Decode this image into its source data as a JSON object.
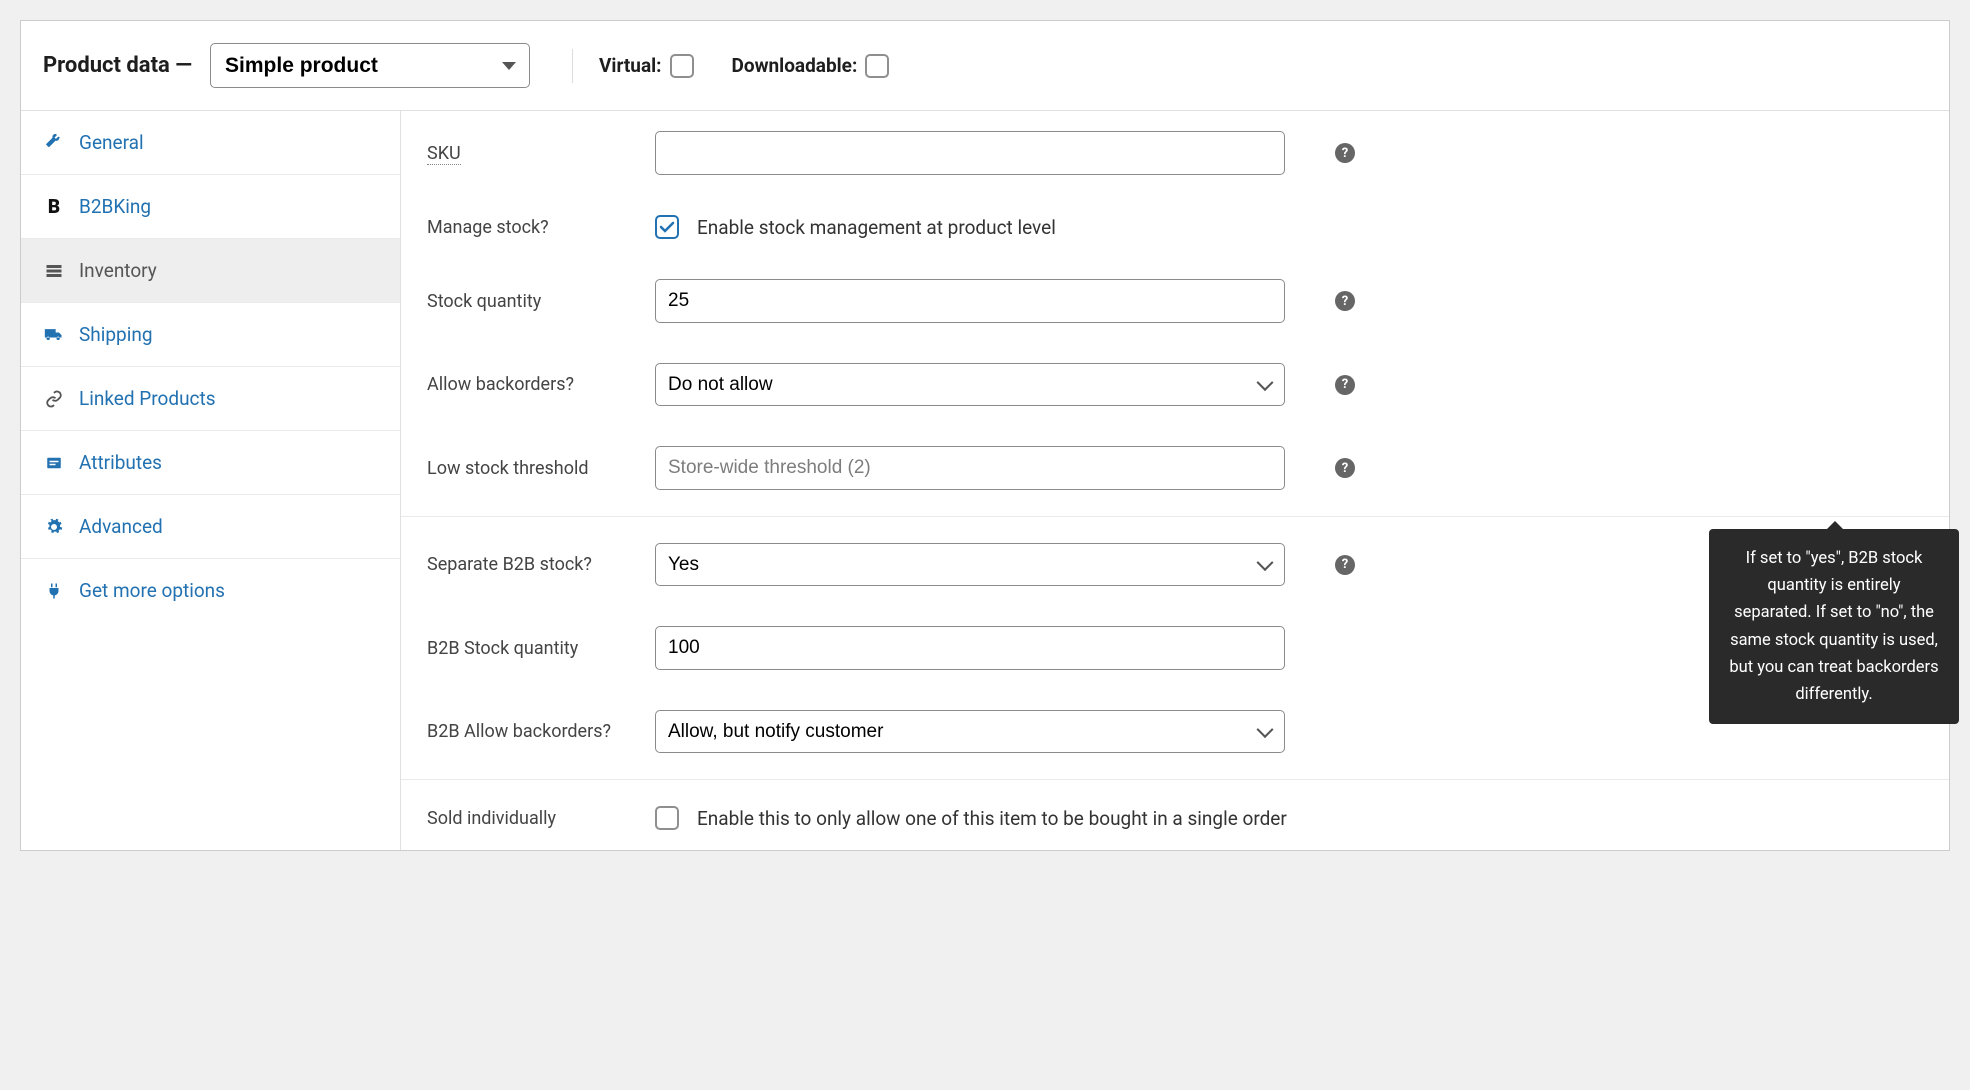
{
  "header": {
    "title": "Product data —",
    "product_type": "Simple product",
    "virtual_label": "Virtual:",
    "downloadable_label": "Downloadable:",
    "virtual_checked": false,
    "downloadable_checked": false
  },
  "tabs": [
    {
      "id": "general",
      "label": "General",
      "icon": "wrench"
    },
    {
      "id": "b2bking",
      "label": "B2BKing",
      "icon": "b2b"
    },
    {
      "id": "inventory",
      "label": "Inventory",
      "icon": "list",
      "active": true
    },
    {
      "id": "shipping",
      "label": "Shipping",
      "icon": "truck"
    },
    {
      "id": "linked",
      "label": "Linked Products",
      "icon": "link"
    },
    {
      "id": "attributes",
      "label": "Attributes",
      "icon": "note"
    },
    {
      "id": "advanced",
      "label": "Advanced",
      "icon": "gear"
    },
    {
      "id": "more",
      "label": "Get more options",
      "icon": "plug"
    }
  ],
  "form": {
    "sku_label": "SKU",
    "sku_value": "",
    "manage_stock_label": "Manage stock?",
    "manage_stock_desc": "Enable stock management at product level",
    "manage_stock_checked": true,
    "stock_qty_label": "Stock quantity",
    "stock_qty_value": "25",
    "allow_backorders_label": "Allow backorders?",
    "allow_backorders_value": "Do not allow",
    "low_stock_label": "Low stock threshold",
    "low_stock_placeholder": "Store-wide threshold (2)",
    "low_stock_value": "",
    "separate_b2b_label": "Separate B2B stock?",
    "separate_b2b_value": "Yes",
    "b2b_stock_qty_label": "B2B Stock quantity",
    "b2b_stock_qty_value": "100",
    "b2b_backorders_label": "B2B Allow backorders?",
    "b2b_backorders_value": "Allow, but notify customer",
    "sold_individually_label": "Sold individually",
    "sold_individually_desc": "Enable this to only allow one of this item to be bought in a single order",
    "sold_individually_checked": false
  },
  "tooltip": {
    "text": "If set to \"yes\", B2B stock quantity is entirely separated. If set to \"no\", the same stock quantity is used, but you can treat backorders differently."
  },
  "icons": {
    "wrench": "🔧",
    "list": "◈",
    "truck": "🚚",
    "link": "🔗",
    "note": "▭",
    "gear": "⚙",
    "plug": "🔌"
  }
}
